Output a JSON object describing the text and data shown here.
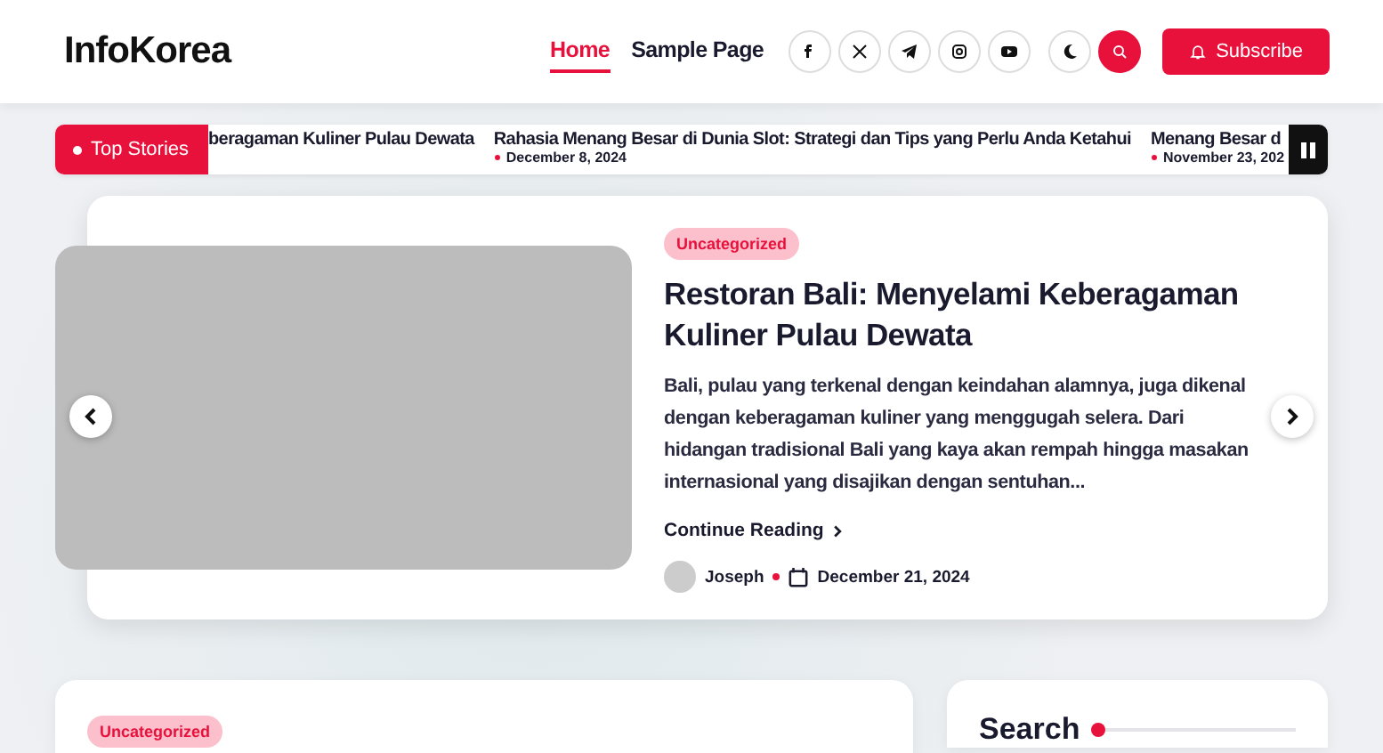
{
  "site_title": "InfoKorea",
  "nav": [
    {
      "label": "Home",
      "selected": true
    },
    {
      "label": "Sample Page",
      "selected": false
    }
  ],
  "social": [
    {
      "kind": "facebook"
    },
    {
      "kind": "x"
    },
    {
      "kind": "telegram"
    },
    {
      "kind": "instagram"
    },
    {
      "kind": "youtube"
    }
  ],
  "subscribe_label": "Subscribe",
  "ticker": {
    "label": "Top Stories",
    "items": [
      {
        "title": "beragaman Kuliner Pulau Dewata"
      },
      {
        "title": "Rahasia Menang Besar di Dunia Slot: Strategi dan Tips yang Perlu Anda Ketahui",
        "date": "December 8, 2024"
      },
      {
        "title": "Menang Besar d",
        "date": "November 23, 202"
      }
    ]
  },
  "featured": {
    "category": "Uncategorized",
    "title": "Restoran Bali: Menyelami Keberagaman Kuliner Pulau Dewata",
    "excerpt": "Bali, pulau yang terkenal dengan keindahan alamnya, juga dikenal dengan keberagaman kuliner yang menggugah selera. Dari hidangan tradisional Bali yang kaya akan rempah hingga masakan internasional yang disajikan dengan sentuhan...",
    "read_more": "Continue Reading",
    "author": "Joseph",
    "date": "December 21, 2024"
  },
  "post": {
    "category": "Uncategorized"
  },
  "sidebar": {
    "heading": "Search"
  }
}
